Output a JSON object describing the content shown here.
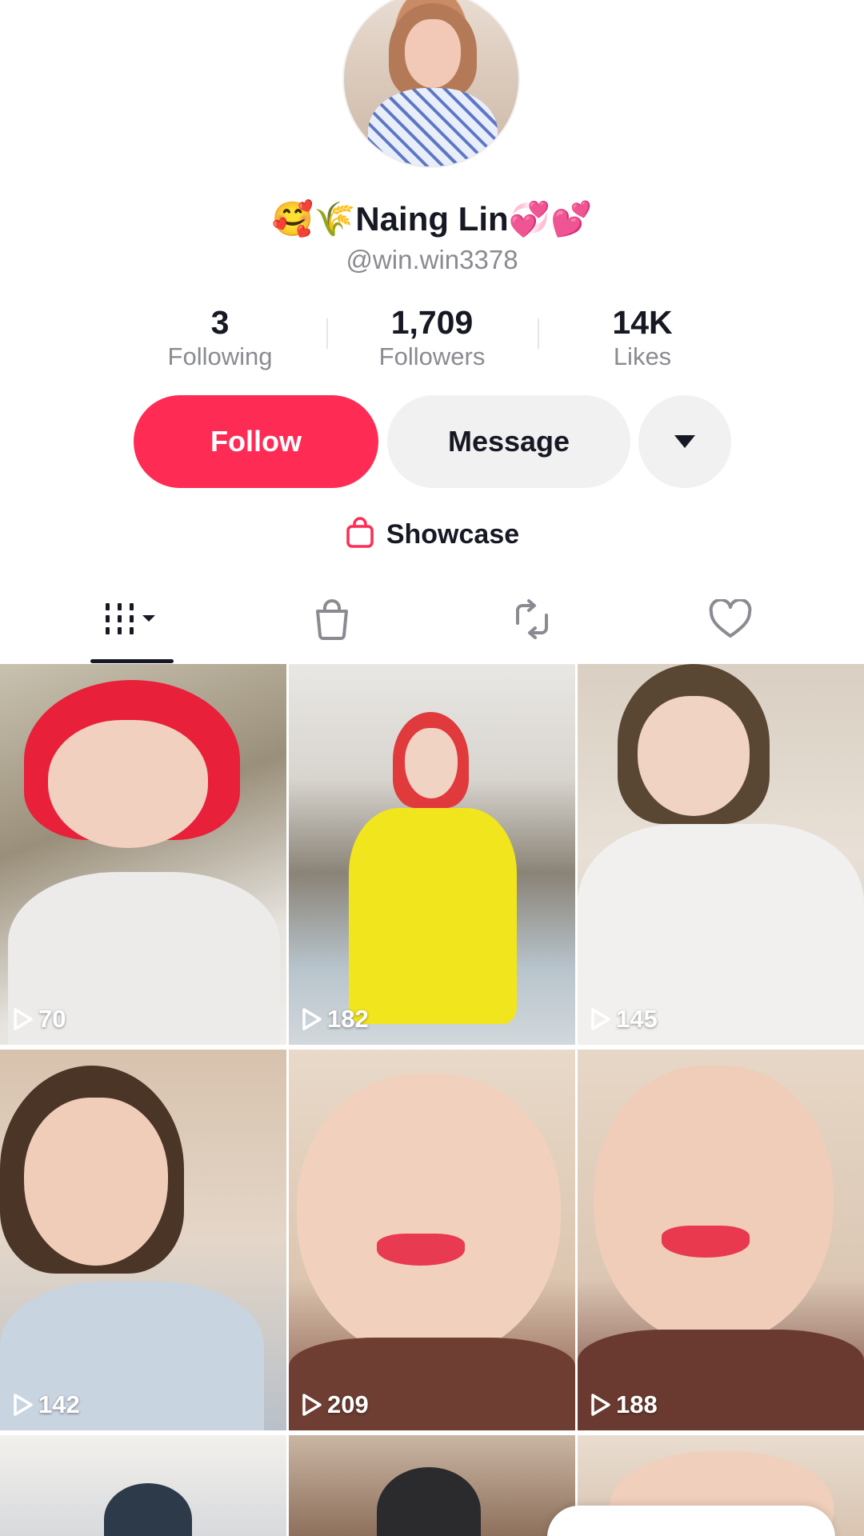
{
  "profile": {
    "display_name": "🥰🌾Naing Lin💞💕",
    "handle": "@win.win3378"
  },
  "stats": [
    {
      "value": "3",
      "label": "Following"
    },
    {
      "value": "1,709",
      "label": "Followers"
    },
    {
      "value": "14K",
      "label": "Likes"
    }
  ],
  "actions": {
    "follow_label": "Follow",
    "message_label": "Message",
    "more_icon": "caret-down-icon"
  },
  "showcase": {
    "label": "Showcase",
    "icon": "shopping-bag-icon"
  },
  "tabs": [
    {
      "icon": "grid-icon",
      "selected": true
    },
    {
      "icon": "shopping-bag-icon",
      "selected": false
    },
    {
      "icon": "repost-icon",
      "selected": false
    },
    {
      "icon": "heart-icon",
      "selected": false
    }
  ],
  "videos": [
    {
      "views": "70"
    },
    {
      "views": "182"
    },
    {
      "views": "145"
    },
    {
      "views": "142"
    },
    {
      "views": "209"
    },
    {
      "views": "188"
    }
  ],
  "colors": {
    "accent": "#fe2c55",
    "secondary_button": "#f1f1f2",
    "text_primary": "#161823",
    "text_secondary": "#8a8b91"
  }
}
